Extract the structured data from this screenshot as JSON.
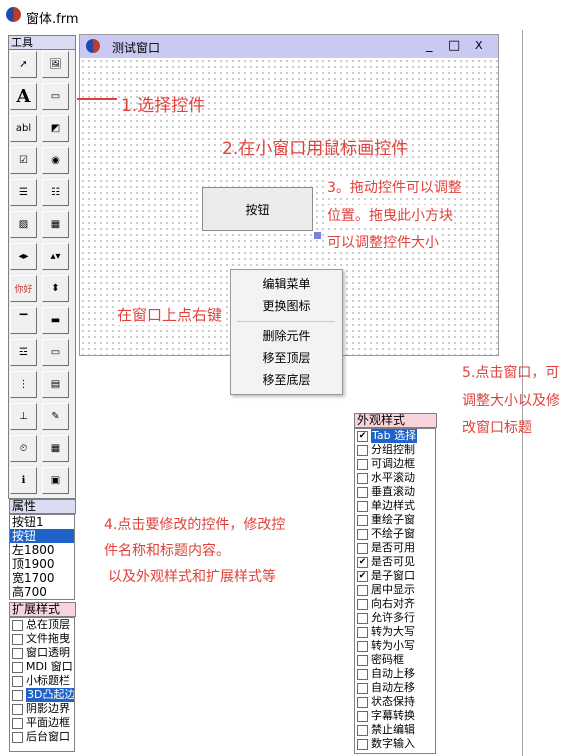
{
  "ide": {
    "title": "窗体.frm"
  },
  "toolbox": {
    "title": "工具",
    "tools": [
      {
        "icon": "pointer-icon",
        "glyph": "➚"
      },
      {
        "icon": "picture-box-icon",
        "glyph": "🖼"
      },
      {
        "icon": "label-tool-icon",
        "glyph": "A"
      },
      {
        "icon": "button-tool-icon",
        "glyph": "▭"
      },
      {
        "icon": "textbox-tool-icon",
        "glyph": "abl"
      },
      {
        "icon": "frame-tool-icon",
        "glyph": "◩"
      },
      {
        "icon": "checkbox-tool-icon",
        "glyph": "☑"
      },
      {
        "icon": "radio-tool-icon",
        "glyph": "◉"
      },
      {
        "icon": "listbox-tool-icon",
        "glyph": "☰"
      },
      {
        "icon": "combobox-tool-icon",
        "glyph": "☷"
      },
      {
        "icon": "image-tool-icon",
        "glyph": "▨"
      },
      {
        "icon": "grid-tool-icon",
        "glyph": "▦"
      },
      {
        "icon": "hscroll-tool-icon",
        "glyph": "◂▸"
      },
      {
        "icon": "vscroll-tool-icon",
        "glyph": "▴▾"
      },
      {
        "icon": "balloon-tool-icon",
        "glyph": "你好"
      },
      {
        "icon": "spin-tool-icon",
        "glyph": "⬍"
      },
      {
        "icon": "tab-tool-icon",
        "glyph": "▔"
      },
      {
        "icon": "progress-tool-icon",
        "glyph": "▬"
      },
      {
        "icon": "toolbar-tool-icon",
        "glyph": "☲"
      },
      {
        "icon": "statusbar-tool-icon",
        "glyph": "▭"
      },
      {
        "icon": "tree-tool-icon",
        "glyph": "⋮"
      },
      {
        "icon": "listview-tool-icon",
        "glyph": "▤"
      },
      {
        "icon": "trackbar-tool-icon",
        "glyph": "⊥"
      },
      {
        "icon": "richtext-tool-icon",
        "glyph": "✎"
      },
      {
        "icon": "timer-tool-icon",
        "glyph": "⏲"
      },
      {
        "icon": "dialog-tool-icon",
        "glyph": "▦"
      },
      {
        "icon": "info-tool-icon",
        "glyph": "ℹ"
      },
      {
        "icon": "film-tool-icon",
        "glyph": "▣"
      }
    ]
  },
  "properties": {
    "title": "属性",
    "rows": [
      {
        "text": "按钮1",
        "selected": false
      },
      {
        "text": "按钮",
        "selected": true
      },
      {
        "text": "左1800",
        "selected": false
      },
      {
        "text": "顶1900",
        "selected": false
      },
      {
        "text": "宽1700",
        "selected": false
      },
      {
        "text": "高700",
        "selected": false
      }
    ]
  },
  "ext_styles": {
    "title": "扩展样式",
    "items": [
      {
        "text": "总在顶层",
        "checked": false,
        "selected": false
      },
      {
        "text": "文件拖曳",
        "checked": false,
        "selected": false
      },
      {
        "text": "窗口透明",
        "checked": false,
        "selected": false
      },
      {
        "text": "MDI 窗口",
        "checked": false,
        "selected": false
      },
      {
        "text": "小标题栏",
        "checked": false,
        "selected": false
      },
      {
        "text": "3D凸起边",
        "checked": false,
        "selected": true
      },
      {
        "text": "阴影边界",
        "checked": false,
        "selected": false
      },
      {
        "text": "平面边框",
        "checked": false,
        "selected": false
      },
      {
        "text": "后台窗口",
        "checked": false,
        "selected": false
      }
    ]
  },
  "appearance_styles": {
    "title": "外观样式",
    "items": [
      {
        "text": "Tab 选择",
        "checked": true,
        "selected": true
      },
      {
        "text": "分组控制",
        "checked": false,
        "selected": false
      },
      {
        "text": "可调边框",
        "checked": false,
        "selected": false
      },
      {
        "text": "水平滚动",
        "checked": false,
        "selected": false
      },
      {
        "text": "垂直滚动",
        "checked": false,
        "selected": false
      },
      {
        "text": "单边样式",
        "checked": false,
        "selected": false
      },
      {
        "text": "重绘子窗",
        "checked": false,
        "selected": false
      },
      {
        "text": "不绘子窗",
        "checked": false,
        "selected": false
      },
      {
        "text": "是否可用",
        "checked": false,
        "selected": false
      },
      {
        "text": "是否可见",
        "checked": true,
        "selected": false
      },
      {
        "text": "是子窗口",
        "checked": true,
        "selected": false
      },
      {
        "text": "居中显示",
        "checked": false,
        "selected": false
      },
      {
        "text": "向右对齐",
        "checked": false,
        "selected": false
      },
      {
        "text": "允许多行",
        "checked": false,
        "selected": false
      },
      {
        "text": "转为大写",
        "checked": false,
        "selected": false
      },
      {
        "text": "转为小写",
        "checked": false,
        "selected": false
      },
      {
        "text": "密码框",
        "checked": false,
        "selected": false
      },
      {
        "text": "自动上移",
        "checked": false,
        "selected": false
      },
      {
        "text": "自动左移",
        "checked": false,
        "selected": false
      },
      {
        "text": "状态保持",
        "checked": false,
        "selected": false
      },
      {
        "text": "字幕转换",
        "checked": false,
        "selected": false
      },
      {
        "text": "禁止编辑",
        "checked": false,
        "selected": false
      },
      {
        "text": "数字输入",
        "checked": false,
        "selected": false
      }
    ]
  },
  "form": {
    "title": "测试窗口",
    "minimize": "_",
    "maximize": "□",
    "close": "X",
    "button_label": "按钮"
  },
  "context_menu": {
    "items": [
      "编辑菜单",
      "更换图标",
      "删除元件",
      "移至顶层",
      "移至底层"
    ]
  },
  "annotations": {
    "step1": "1.选择控件",
    "step2": "2.在小窗口用鼠标画控件",
    "step3_line1": "3。拖动控件可以调整",
    "step3_line2": "位置。拖曳此小方块",
    "step3_line3": "可以调整控件大小",
    "right_click": "在窗口上点右键",
    "step4_line1": "4.点击要修改的控件，修改控",
    "step4_line2": "件名称和标题内容。",
    "step4_line3": "以及外观样式和扩展样式等",
    "step5_line1": "5.点击窗口，可",
    "step5_line2": "调整大小以及修",
    "step5_line3": "改窗口标题"
  },
  "colors": {
    "annotation": "#e0413a",
    "selection": "#1f62c9",
    "form_title": "#c9c9f2"
  }
}
